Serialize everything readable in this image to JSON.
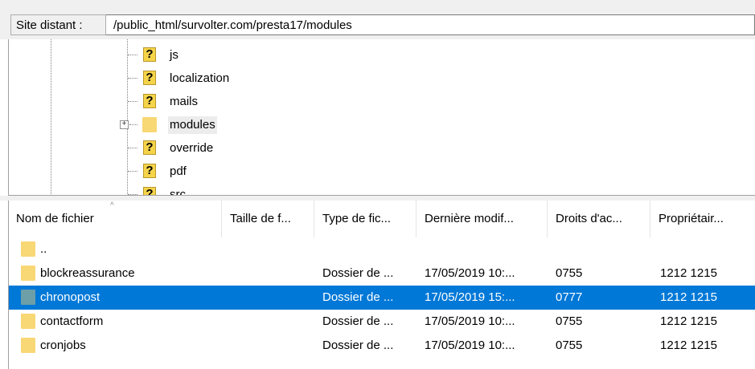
{
  "site_bar": {
    "label": "Site distant :",
    "path": "/public_html/survolter.com/presta17/modules"
  },
  "tree": {
    "items": [
      {
        "name": "js",
        "icon": "question-icon"
      },
      {
        "name": "localization",
        "icon": "question-icon"
      },
      {
        "name": "mails",
        "icon": "question-icon"
      },
      {
        "name": "modules",
        "icon": "folder-icon",
        "selected": true,
        "expandable": true
      },
      {
        "name": "override",
        "icon": "question-icon"
      },
      {
        "name": "pdf",
        "icon": "question-icon"
      },
      {
        "name": "src",
        "icon": "question-icon"
      }
    ]
  },
  "file_list": {
    "columns": [
      "Nom de fichier",
      "Taille de f...",
      "Type de fic...",
      "Dernière modif...",
      "Droits d'ac...",
      "Propriétair..."
    ],
    "rows": [
      {
        "name": "..",
        "size": "",
        "type": "",
        "modified": "",
        "perms": "",
        "owner": ""
      },
      {
        "name": "blockreassurance",
        "size": "",
        "type": "Dossier de ...",
        "modified": "17/05/2019 10:...",
        "perms": "0755",
        "owner": "1212 1215"
      },
      {
        "name": "chronopost",
        "size": "",
        "type": "Dossier de ...",
        "modified": "17/05/2019 15:...",
        "perms": "0777",
        "owner": "1212 1215",
        "selected": true
      },
      {
        "name": "contactform",
        "size": "",
        "type": "Dossier de ...",
        "modified": "17/05/2019 10:...",
        "perms": "0755",
        "owner": "1212 1215"
      },
      {
        "name": "cronjobs",
        "size": "",
        "type": "Dossier de ...",
        "modified": "17/05/2019 10:...",
        "perms": "0755",
        "owner": "1212 1215"
      }
    ]
  },
  "colors": {
    "selection": "#0078d7",
    "folder": "#f8d775",
    "question_icon": "#f5d44a"
  }
}
